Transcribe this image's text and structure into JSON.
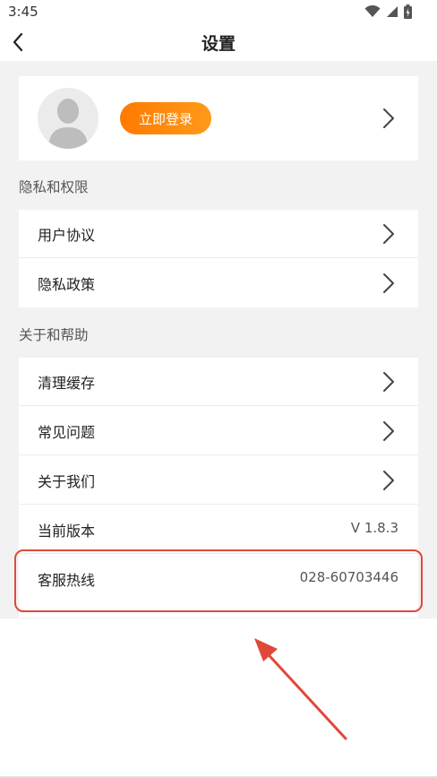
{
  "status_bar": {
    "time": "3:45",
    "icons": [
      "wifi-icon",
      "signal-icon",
      "battery-icon"
    ]
  },
  "header": {
    "title": "设置",
    "back_icon": "chevron-left-icon"
  },
  "profile": {
    "login_label": "立即登录",
    "avatar_icon": "avatar-placeholder-icon"
  },
  "privacy_section": {
    "label": "隐私和权限",
    "items": [
      {
        "label": "用户协议"
      },
      {
        "label": "隐私政策"
      }
    ]
  },
  "about_section": {
    "label": "关于和帮助",
    "items": [
      {
        "label": "清理缓存"
      },
      {
        "label": "常见问题"
      },
      {
        "label": "关于我们"
      },
      {
        "label": "当前版本",
        "value": "V 1.8.3"
      },
      {
        "label": "客服热线",
        "value": "028-60703446"
      }
    ]
  },
  "colors": {
    "accent": "#ff8400",
    "background": "#f2f2f2",
    "highlight": "#e0483a"
  }
}
